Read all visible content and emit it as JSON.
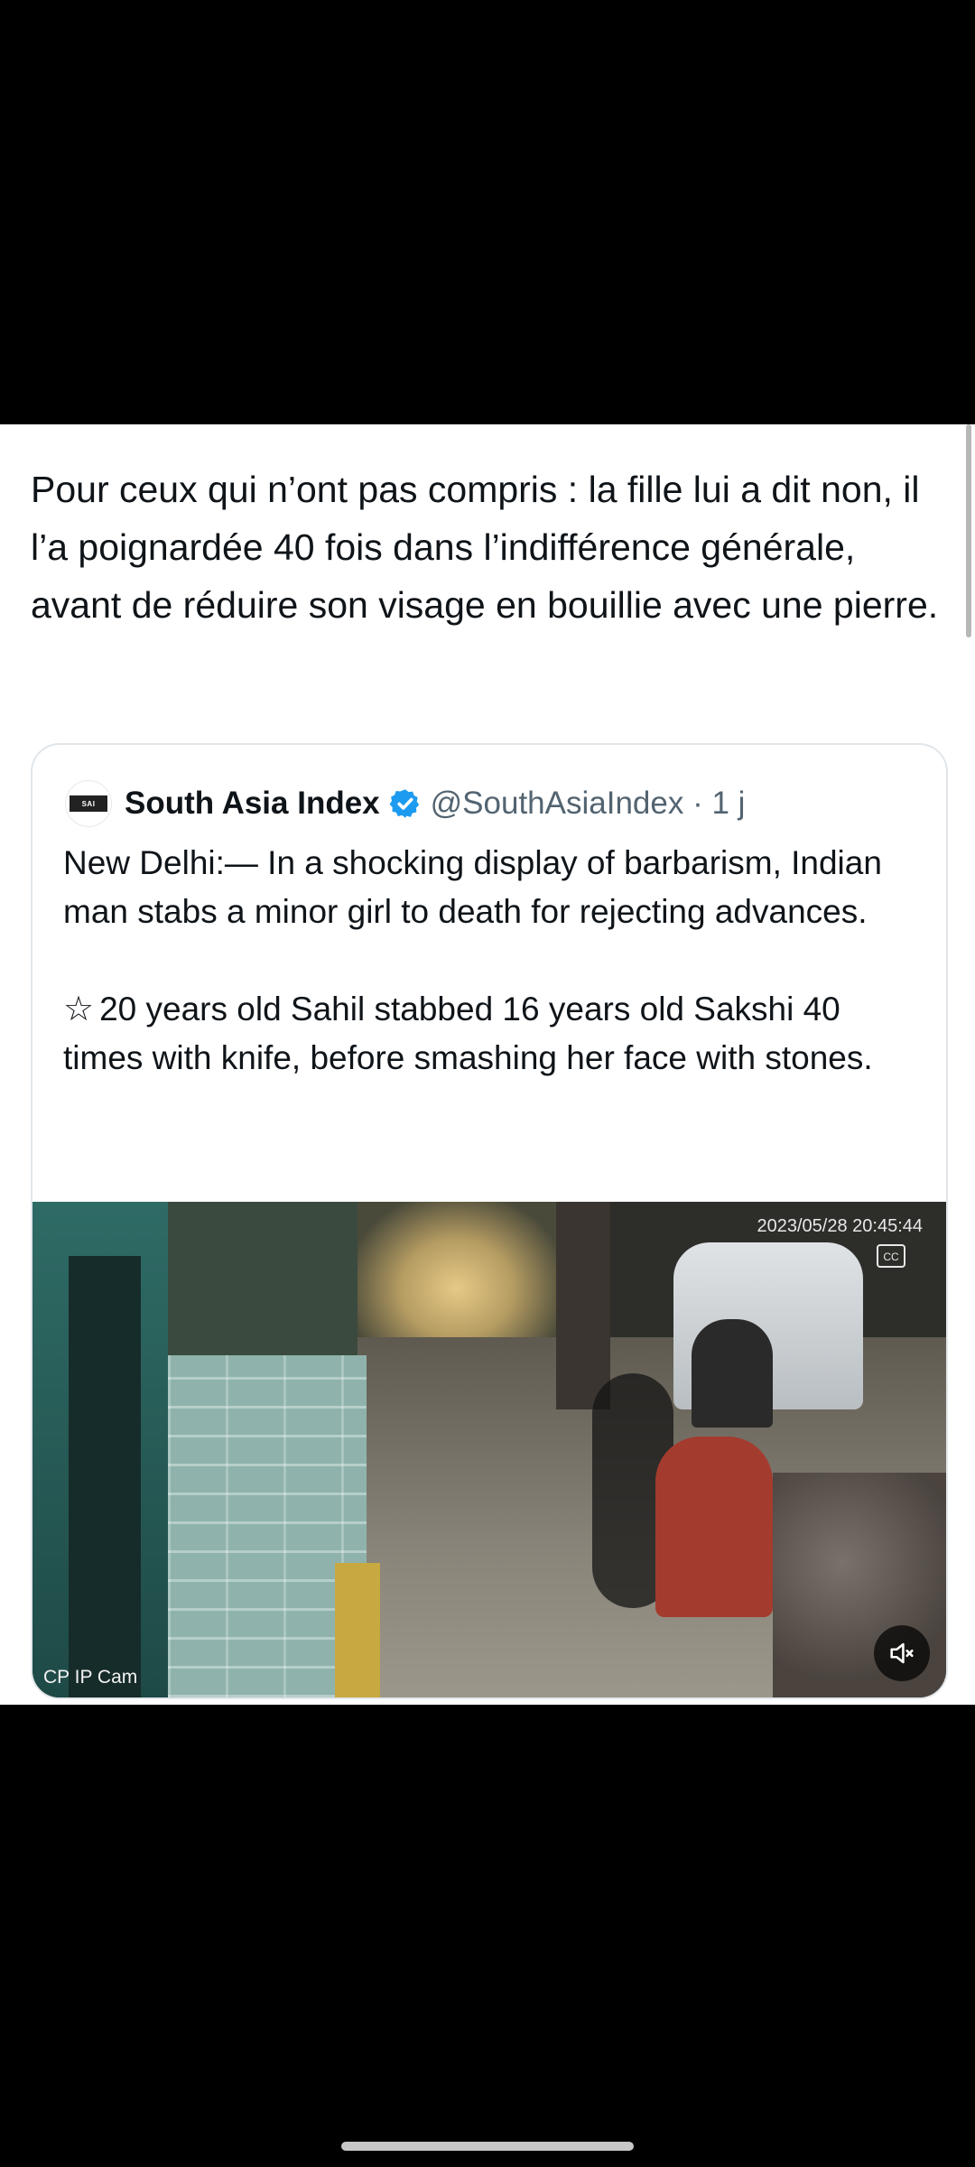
{
  "post": {
    "text": "Pour ceux qui n’ont pas compris : la fille lui a dit non, il l’a poignardée 40 fois dans l’indifférence générale, avant de réduire son visage en bouillie avec une pierre."
  },
  "quoted_tweet": {
    "avatar_logo_text": "SOUTH ASIA INDEX",
    "author_name": "South Asia Index",
    "verified_color": "#1d9bf0",
    "handle_time": "@SouthAsiaIndex · 1 j",
    "paragraph_1": "New Delhi:— In a shocking display of barbarism, Indian man stabs a minor girl to death for rejecting advances.",
    "star_symbol": "☆",
    "paragraph_2": "20 years old Sahil stabbed 16 years old Sakshi 40 times with knife, before smashing her face with stones.",
    "media": {
      "timestamp": "2023/05/28 20:45:44",
      "camera_label": "CP IP Cam",
      "cc_icon": "closed-captions-icon",
      "mute_icon": "speaker-muted-icon"
    }
  }
}
